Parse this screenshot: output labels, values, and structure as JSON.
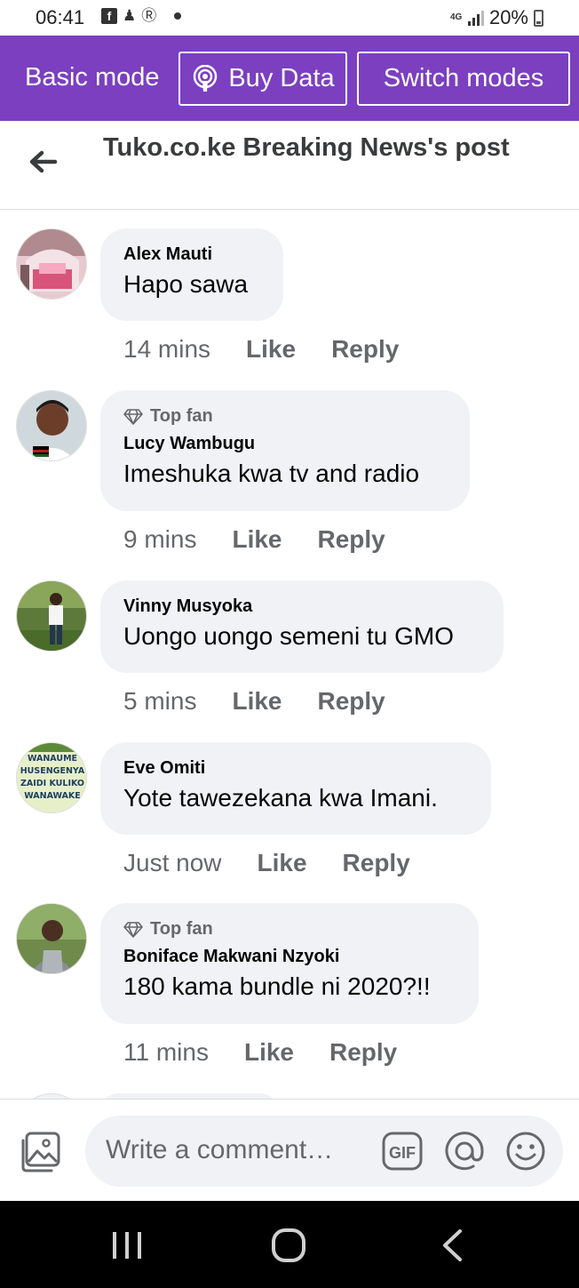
{
  "status_bar": {
    "time": "06:41",
    "network": "4G",
    "battery": "20%"
  },
  "mode_bar": {
    "basic_mode_label": "Basic mode",
    "buy_data_label": "Buy Data",
    "switch_modes_label": "Switch modes",
    "background_color": "#7b3fc0"
  },
  "header": {
    "title": "Tuko.co.ke Breaking News's post"
  },
  "comments": [
    {
      "author": "Alex Mauti",
      "badge": "",
      "text": "Hapo sawa",
      "time": "14 mins",
      "like": "Like",
      "reply": "Reply"
    },
    {
      "author": "Lucy Wambugu",
      "badge": "Top fan",
      "text": "Imeshuka kwa tv and radio",
      "time": "9 mins",
      "like": "Like",
      "reply": "Reply"
    },
    {
      "author": "Vinny Musyoka",
      "badge": "",
      "text": "Uongo uongo semeni tu GMO",
      "time": "5 mins",
      "like": "Like",
      "reply": "Reply"
    },
    {
      "author": "Eve Omiti",
      "badge": "",
      "text": "Yote tawezekana kwa Imani.",
      "time": "Just now",
      "like": "Like",
      "reply": "Reply",
      "avatar_text": [
        "WANAUME",
        "HUSENGENYA",
        "ZAIDI KULIKO",
        "WANAWAKE"
      ]
    },
    {
      "author": "Boniface Makwani Nzyoki",
      "badge": "Top fan",
      "text": "180 kama bundle ni 2020?!!",
      "time": "11 mins",
      "like": "Like",
      "reply": "Reply"
    }
  ],
  "composer": {
    "placeholder": "Write a comment…",
    "gif_label": "GIF"
  },
  "icons": {
    "back": "back-arrow-icon",
    "photo": "photo-icon",
    "gif": "gif-icon",
    "mention": "at-icon",
    "emoji": "smile-icon",
    "podcast": "podcast-icon",
    "top_fan": "diamond-icon"
  }
}
